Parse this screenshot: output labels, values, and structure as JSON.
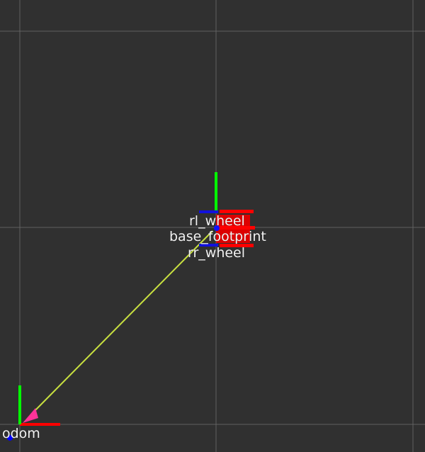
{
  "scene": {
    "background_color": "#303030",
    "grid_color": "#8a8a8a",
    "frames": [
      {
        "id": "odom",
        "label": "odom"
      },
      {
        "id": "rl_wheel",
        "label": "rl_wheel"
      },
      {
        "id": "base_footprint",
        "label": "base_footprint"
      },
      {
        "id": "rr_wheel",
        "label": "rr_wheel"
      }
    ],
    "axis_colors": {
      "x": "#ff0000",
      "y": "#00ff00",
      "z": "#0000ff"
    },
    "tf_link_color": "#c8e040",
    "tf_arrow_color": "#ff3399"
  }
}
